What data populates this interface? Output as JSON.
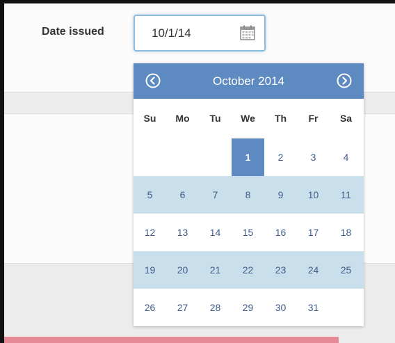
{
  "form": {
    "date_label": "Date issued",
    "date_value": "10/1/14",
    "calendar_icon": "calendar-icon"
  },
  "datepicker": {
    "month_label": "October 2014",
    "prev_icon": "chevron-left-circle-icon",
    "next_icon": "chevron-right-circle-icon",
    "weekdays": [
      "Su",
      "Mo",
      "Tu",
      "We",
      "Th",
      "Fr",
      "Sa"
    ],
    "selected_day": "1",
    "weeks": [
      [
        "",
        "",
        "",
        "1",
        "2",
        "3",
        "4"
      ],
      [
        "5",
        "6",
        "7",
        "8",
        "9",
        "10",
        "11"
      ],
      [
        "12",
        "13",
        "14",
        "15",
        "16",
        "17",
        "18"
      ],
      [
        "19",
        "20",
        "21",
        "22",
        "23",
        "24",
        "25"
      ],
      [
        "26",
        "27",
        "28",
        "29",
        "30",
        "31",
        ""
      ]
    ]
  },
  "colors": {
    "header": "#5d8ac0",
    "shaded_row": "#c9dfeb",
    "day_text": "#3f5d8a",
    "accent_bar": "#e68a96"
  }
}
